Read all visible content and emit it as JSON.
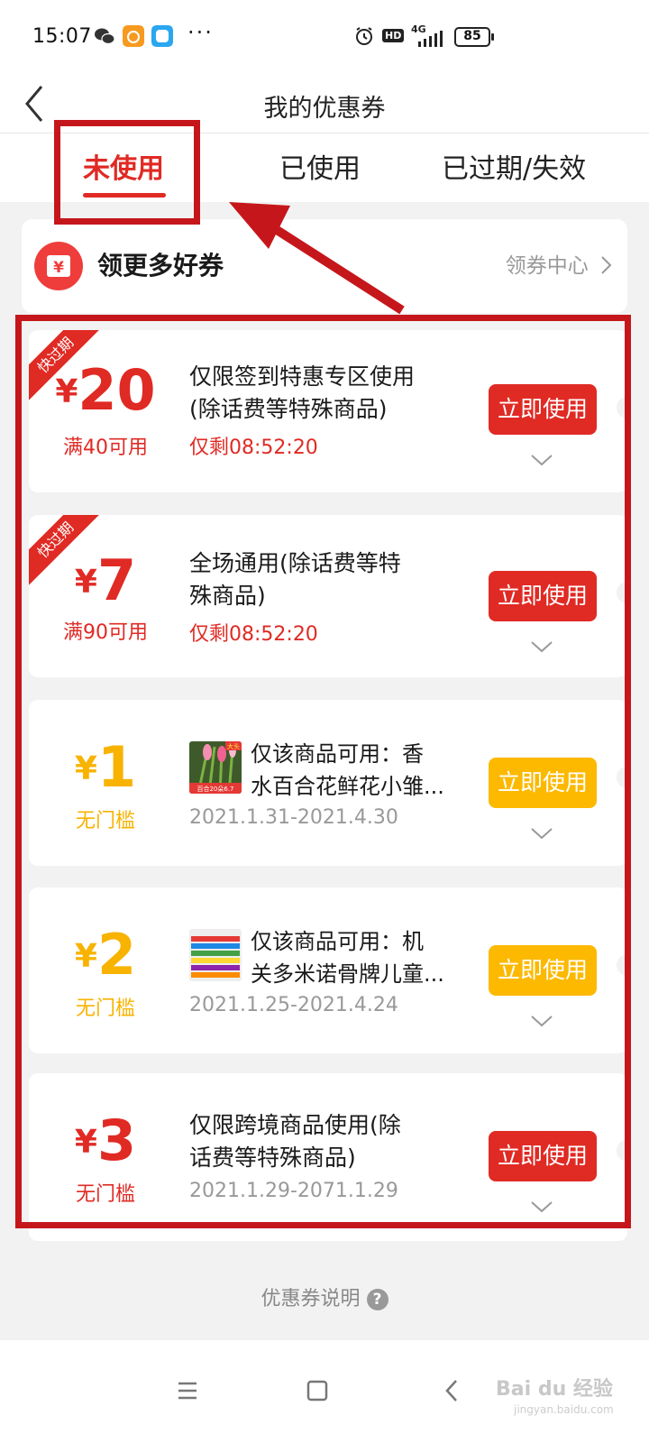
{
  "status_bar": {
    "time": "15:07",
    "network": "4G",
    "hd": "HD",
    "battery": "85",
    "more": "···"
  },
  "header": {
    "title": "我的优惠券"
  },
  "tabs": [
    {
      "label": "未使用",
      "active": true
    },
    {
      "label": "已使用",
      "active": false
    },
    {
      "label": "已过期/失效",
      "active": false
    }
  ],
  "promo": {
    "title": "领更多好券",
    "link": "领券中心",
    "icon_glyph": "¥"
  },
  "coupons": [
    {
      "badge": "快过期",
      "currency": "¥",
      "amount": "20",
      "condition": "满40可用",
      "desc_lines": [
        "仅限签到特惠专区使用",
        "(除话费等特殊商品)"
      ],
      "sub": "仅剩08:52:20",
      "button": "立即使用",
      "color": "#e02a24"
    },
    {
      "badge": "快过期",
      "currency": "¥",
      "amount": "7",
      "condition": "满90可用",
      "desc_lines": [
        "全场通用(除话费等特",
        "殊商品)"
      ],
      "sub": "仅剩08:52:20",
      "button": "立即使用",
      "color": "#e02a24"
    },
    {
      "currency": "¥",
      "amount": "1",
      "condition": "无门槛",
      "desc_lines": [
        "仅该商品可用：香",
        "水百合花鲜花小雏..."
      ],
      "thumb_text": [
        "大头",
        "百合20朵6.7"
      ],
      "sub": "2021.1.31-2021.4.30",
      "button": "立即使用",
      "color": "#f8b300"
    },
    {
      "currency": "¥",
      "amount": "2",
      "condition": "无门槛",
      "desc_lines": [
        "仅该商品可用：机",
        "关多米诺骨牌儿童..."
      ],
      "sub": "2021.1.25-2021.4.24",
      "button": "立即使用",
      "color": "#f8b300"
    },
    {
      "currency": "¥",
      "amount": "3",
      "condition": "无门槛",
      "desc_lines": [
        "仅限跨境商品使用(除",
        "话费等特殊商品)"
      ],
      "sub": "2021.1.29-2071.1.29",
      "button": "立即使用",
      "color": "#e02a24"
    }
  ],
  "footer": {
    "explain": "优惠券说明",
    "help": "?"
  },
  "watermark": {
    "text": "Bai du 经验",
    "sub": "jingyan.baidu.com"
  }
}
